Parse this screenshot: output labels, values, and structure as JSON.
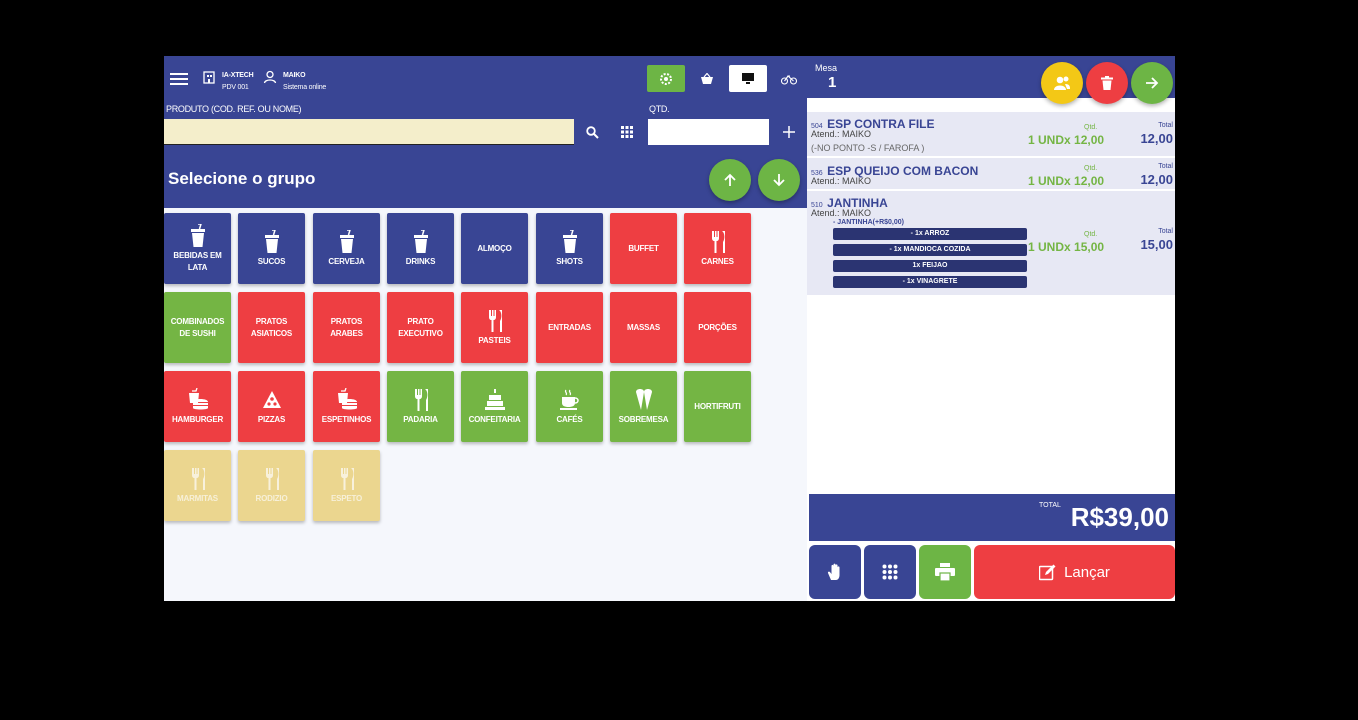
{
  "header": {
    "company_name": "IA-XTECH",
    "pdv": "PDV 001",
    "user_name": "MAIKO",
    "system_status": "Sistema online"
  },
  "search": {
    "product_label": "PRODUTO (COD. REF. OU NOME)",
    "product_value": "",
    "qty_label": "QTD.",
    "qty_value": ""
  },
  "groups": {
    "title": "Selecione o grupo",
    "items": [
      {
        "label": "BEBIDAS EM LATA",
        "color": "blue",
        "icon": "drink-cup-icon"
      },
      {
        "label": "SUCOS",
        "color": "blue",
        "icon": "drink-cup-icon"
      },
      {
        "label": "CERVEJA",
        "color": "blue",
        "icon": "drink-cup-icon"
      },
      {
        "label": "DRINKS",
        "color": "blue",
        "icon": "drink-cup-icon"
      },
      {
        "label": "ALMOÇO",
        "color": "blue",
        "icon": ""
      },
      {
        "label": "SHOTS",
        "color": "blue",
        "icon": "drink-cup-icon"
      },
      {
        "label": "BUFFET",
        "color": "red",
        "icon": ""
      },
      {
        "label": "CARNES",
        "color": "red",
        "icon": "cutlery-icon"
      },
      {
        "label": "COMBINADOS DE SUSHI",
        "color": "green",
        "icon": ""
      },
      {
        "label": "PRATOS ASIATICOS",
        "color": "red",
        "icon": ""
      },
      {
        "label": "PRATOS ARABES",
        "color": "red",
        "icon": ""
      },
      {
        "label": "PRATO EXECUTIVO",
        "color": "red",
        "icon": ""
      },
      {
        "label": "PASTEIS",
        "color": "red",
        "icon": "cutlery-icon"
      },
      {
        "label": "ENTRADAS",
        "color": "red",
        "icon": ""
      },
      {
        "label": "MASSAS",
        "color": "red",
        "icon": ""
      },
      {
        "label": "PORÇÕES",
        "color": "red",
        "icon": ""
      },
      {
        "label": "HAMBURGER",
        "color": "red",
        "icon": "fastfood-icon"
      },
      {
        "label": "PIZZAS",
        "color": "red",
        "icon": "pizza-icon"
      },
      {
        "label": "ESPETINHOS",
        "color": "red",
        "icon": "fastfood-icon"
      },
      {
        "label": "PADARIA",
        "color": "green",
        "icon": "cutlery-icon"
      },
      {
        "label": "CONFEITARIA",
        "color": "green",
        "icon": "cake-icon"
      },
      {
        "label": "CAFÉS",
        "color": "green",
        "icon": "coffee-icon"
      },
      {
        "label": "SOBREMESA",
        "color": "green",
        "icon": "icecream-icon"
      },
      {
        "label": "HORTIFRUTI",
        "color": "green",
        "icon": ""
      },
      {
        "label": "MARMITAS",
        "color": "yellow",
        "icon": "cutlery-icon"
      },
      {
        "label": "RODIZIO",
        "color": "yellow",
        "icon": "cutlery-icon"
      },
      {
        "label": "ESPETO",
        "color": "yellow",
        "icon": "cutlery-icon"
      }
    ]
  },
  "order": {
    "table_label": "Mesa",
    "table_number": "1",
    "items": [
      {
        "code": "504",
        "name": "ESP CONTRA FILE",
        "attendant": "Atend.: MAIKO",
        "note": "(-NO PONTO -S / FAROFA )",
        "qty_label": "Qtd.",
        "qty": "1 UNDx 12,00",
        "total_label": "Total",
        "total": "12,00"
      },
      {
        "code": "536",
        "name": "ESP QUEIJO COM BACON",
        "attendant": "Atend.: MAIKO",
        "note": "",
        "qty_label": "Qtd.",
        "qty": "1 UNDx 12,00",
        "total_label": "Total",
        "total": "12,00"
      },
      {
        "code": "510",
        "name": "JANTINHA",
        "attendant": "Atend.: MAIKO",
        "note": "- JANTINHA(+R$0,00)",
        "qty_label": "Qtd.",
        "qty": "1 UNDx 15,00",
        "total_label": "Total",
        "total": "15,00",
        "subs": [
          "- 1x ARROZ",
          "- 1x MANDIOCA COZIDA",
          "1x FEIJAO",
          "- 1x VINAGRETE"
        ]
      }
    ],
    "total_label": "TOTAL",
    "total_value": "R$39,00",
    "launch_label": "Lançar"
  },
  "colors": {
    "primary": "#394594",
    "green": "#74b544",
    "red": "#ee3e42",
    "yellow": "#ebd68f",
    "accent_yellow": "#f3c816"
  }
}
